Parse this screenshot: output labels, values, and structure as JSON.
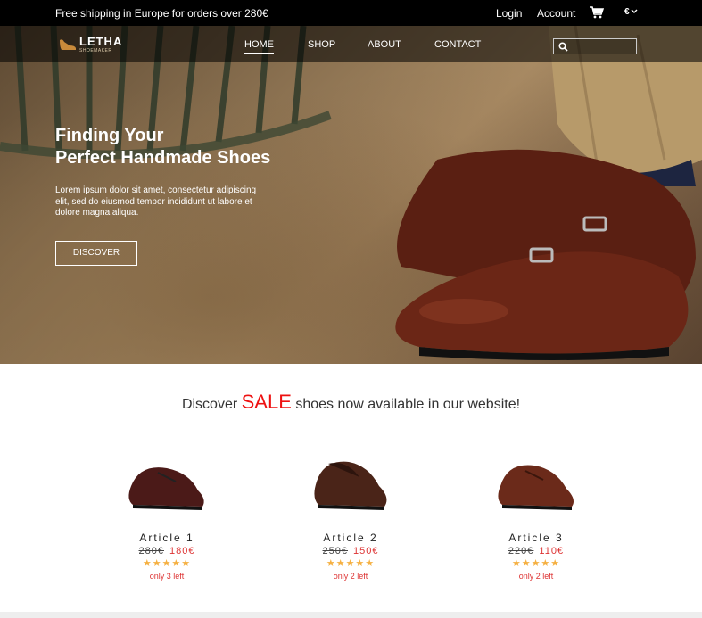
{
  "topbar": {
    "promo": "Free shipping in Europe for orders over 280€",
    "login": "Login",
    "account": "Account",
    "currency": "€"
  },
  "nav": {
    "logo_name": "LETHA",
    "logo_sub": "SHOEMAKER",
    "links": [
      "HOME",
      "SHOP",
      "ABOUT",
      "CONTACT"
    ],
    "active": "HOME",
    "search_placeholder": ""
  },
  "hero": {
    "headline_line1": "Finding Your",
    "headline_line2": "Perfect Handmade Shoes",
    "body": "Lorem ipsum dolor sit amet, consectetur adipiscing elit, sed do eiusmod tempor incididunt ut labore et dolore magna aliqua.",
    "button": "DISCOVER"
  },
  "sale": {
    "prefix": "Discover",
    "highlight": "SALE",
    "suffix": "shoes now available in our website!"
  },
  "products": [
    {
      "name": "Article 1",
      "old_price": "280€",
      "new_price": "180€",
      "rating": 5,
      "stock": "only 3 left"
    },
    {
      "name": "Article 2",
      "old_price": "250€",
      "new_price": "150€",
      "rating": 5,
      "stock": "only 2 left"
    },
    {
      "name": "Article 3",
      "old_price": "220€",
      "new_price": "110€",
      "rating": 5,
      "stock": "only 2 left"
    }
  ],
  "colors": {
    "topbar_bg": "#000000",
    "sale_accent": "#ee1111",
    "price_red": "#dd3333",
    "star": "#f5b041"
  }
}
